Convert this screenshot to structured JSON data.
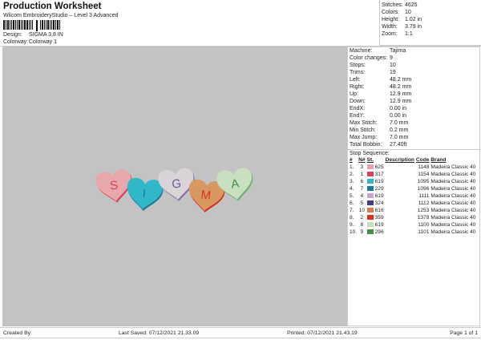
{
  "header": {
    "title": "Production Worksheet",
    "subtitle": "Wilcom EmbroideryStudio – Level 3 Advanced",
    "design_label": "Design:",
    "design_value": "SIGMA 3,8 IN",
    "colorway_label": "Colorway:",
    "colorway_value": "Colorway 1"
  },
  "info": [
    {
      "label": "Stitches:",
      "value": "4625"
    },
    {
      "label": "Colors:",
      "value": "10"
    },
    {
      "label": "Height:",
      "value": "1.02 in"
    },
    {
      "label": "Width:",
      "value": "3.79 in"
    },
    {
      "label": "Zoom:",
      "value": "1:1"
    }
  ],
  "machine": [
    {
      "label": "Machine:",
      "value": "Tajima"
    },
    {
      "label": "Color changes:",
      "value": "9"
    },
    {
      "label": "Stops:",
      "value": "10"
    },
    {
      "label": "Trims:",
      "value": "19"
    },
    {
      "label": "Left:",
      "value": "48.2 mm"
    },
    {
      "label": "Right:",
      "value": "48.2 mm"
    },
    {
      "label": "Up:",
      "value": "12.9 mm"
    },
    {
      "label": "Down:",
      "value": "12.9 mm"
    },
    {
      "label": "EndX:",
      "value": "0.00 in"
    },
    {
      "label": "EndY:",
      "value": "0.00 in"
    },
    {
      "label": "Max Stitch:",
      "value": "7.0 mm"
    },
    {
      "label": "Min Stitch:",
      "value": "0.2 mm"
    },
    {
      "label": "Max Jump:",
      "value": "7.0 mm"
    },
    {
      "label": "Total Bobbin:",
      "value": "27.40ft"
    }
  ],
  "stop_sequence": {
    "title": "Stop Sequence:",
    "headers": [
      "#",
      "N#",
      "St.",
      "Description",
      "Code",
      "Brand"
    ],
    "rows": [
      {
        "idx": "1.",
        "n": "3",
        "st": "625",
        "desc": "",
        "code": "1148",
        "brand": "Madeira Classic 40",
        "color": "#e8a0b0"
      },
      {
        "idx": "2.",
        "n": "1",
        "st": "317",
        "desc": "",
        "code": "1154",
        "brand": "Madeira Classic 40",
        "color": "#d9405a"
      },
      {
        "idx": "3.",
        "n": "6",
        "st": "619",
        "desc": "",
        "code": "1095",
        "brand": "Madeira Classic 40",
        "color": "#30b8c8"
      },
      {
        "idx": "4.",
        "n": "7",
        "st": "229",
        "desc": "",
        "code": "1096",
        "brand": "Madeira Classic 40",
        "color": "#1a7a98"
      },
      {
        "idx": "5.",
        "n": "4",
        "st": "619",
        "desc": "",
        "code": "1111",
        "brand": "Madeira Classic 40",
        "color": "#c8a8d0"
      },
      {
        "idx": "6.",
        "n": "5",
        "st": "324",
        "desc": "",
        "code": "1112",
        "brand": "Madeira Classic 40",
        "color": "#4a3a80"
      },
      {
        "idx": "7.",
        "n": "10",
        "st": "616",
        "desc": "",
        "code": "1253",
        "brand": "Madeira Classic 40",
        "color": "#d87a50"
      },
      {
        "idx": "8.",
        "n": "2",
        "st": "359",
        "desc": "",
        "code": "1378",
        "brand": "Madeira Classic 40",
        "color": "#d83020"
      },
      {
        "idx": "9.",
        "n": "8",
        "st": "619",
        "desc": "",
        "code": "1100",
        "brand": "Madeira Classic 40",
        "color": "#c8dcc0"
      },
      {
        "idx": "10.",
        "n": "9",
        "st": "296",
        "desc": "",
        "code": "1101",
        "brand": "Madeira Classic 40",
        "color": "#40904a"
      }
    ]
  },
  "design": {
    "hearts": [
      {
        "letter": "S",
        "fill": "#e6a8aa",
        "edge": "#d9405a",
        "text": "#d9405a"
      },
      {
        "letter": "I",
        "fill": "#30b8c8",
        "edge": "#1a7a98",
        "text": "#1a7a98"
      },
      {
        "letter": "G",
        "fill": "#d8d4d8",
        "edge": "#8070a8",
        "text": "#6a5a98"
      },
      {
        "letter": "M",
        "fill": "#d89860",
        "edge": "#d83020",
        "text": "#d83020"
      },
      {
        "letter": "A",
        "fill": "#c8e0c0",
        "edge": "#70b070",
        "text": "#40904a"
      }
    ]
  },
  "footer": {
    "created_by": "Created By:",
    "last_saved": "Last Saved: 07/12/2021 21.33.09",
    "printed": "Printed: 07/12/2021 21.43.19",
    "page": "Page 1 of 1"
  }
}
